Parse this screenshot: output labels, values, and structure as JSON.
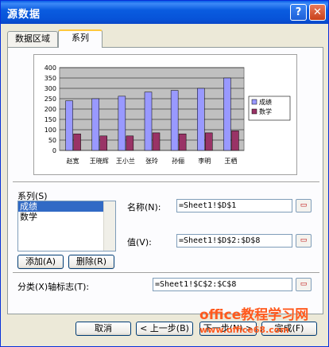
{
  "window": {
    "title": "源数据",
    "help_glyph": "?",
    "close_glyph": "✕"
  },
  "tabs": [
    {
      "label": "数据区域",
      "active": false
    },
    {
      "label": "系列",
      "active": true
    }
  ],
  "chart_data": {
    "type": "bar",
    "categories": [
      "赵宽",
      "王晓辉",
      "王小兰",
      "张玲",
      "孙俪",
      "李明",
      "王栖"
    ],
    "series": [
      {
        "name": "成绩",
        "values": [
          240,
          250,
          262,
          282,
          290,
          300,
          350
        ],
        "color": "#9999ff"
      },
      {
        "name": "数学",
        "values": [
          80,
          70,
          70,
          85,
          80,
          85,
          95
        ],
        "color": "#993366"
      }
    ],
    "ylim": [
      0,
      400
    ],
    "yticks": [
      "0",
      "50",
      "100",
      "150",
      "200",
      "250",
      "300",
      "350",
      "400"
    ],
    "grid": true,
    "plot_background": "#c0c0c0",
    "legend_position": "right"
  },
  "series_section": {
    "label": "系列(S)",
    "items": [
      {
        "label": "成绩",
        "selected": true
      },
      {
        "label": "数学",
        "selected": false
      }
    ],
    "add_button": "添加(A)",
    "delete_button": "删除(R)"
  },
  "name_field": {
    "label": "名称(N):",
    "value": "=Sheet1!$D$1"
  },
  "value_field": {
    "label": "值(V):",
    "value": "=Sheet1!$D$2:$D$8"
  },
  "category_field": {
    "label": "分类(X)轴标志(T):",
    "value": "=Sheet1!$C$2:$C$8"
  },
  "ref_button_glyph": "▭",
  "footer": {
    "cancel": "取消",
    "back": "< 上一步(B)",
    "next": "下一步(N) >",
    "finish": "完成(F)"
  },
  "watermark": {
    "line1": "office教程学习网",
    "line2": "www.office68.com"
  }
}
